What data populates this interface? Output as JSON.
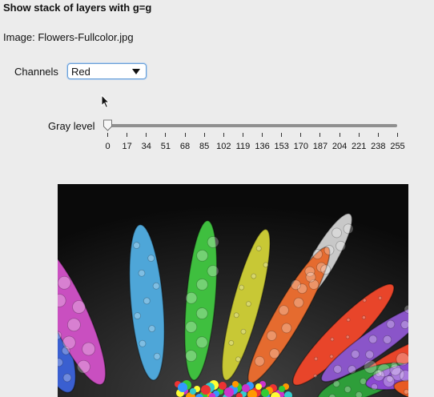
{
  "header": {
    "title": "Show stack of layers with g=g"
  },
  "image": {
    "label": "Image: Flowers-Fullcolor.jpg"
  },
  "channels": {
    "label": "Channels",
    "selected": "Red"
  },
  "gray_level": {
    "label": "Gray level",
    "value": 0,
    "min": 0,
    "max": 255,
    "ticks": [
      "0",
      "17",
      "34",
      "51",
      "68",
      "85",
      "102",
      "119",
      "136",
      "153",
      "170",
      "187",
      "204",
      "221",
      "238",
      "255"
    ]
  },
  "photo": {
    "petal_colors": [
      "#e8362c",
      "#3a5fd0",
      "#c94fc0",
      "#4ea6d8",
      "#3fbf3f",
      "#c8c835",
      "#e56b2f",
      "#e8452a",
      "#8a55c9",
      "#e8452a",
      "#2e9e3a",
      "#8a48d0",
      "#e85a22",
      "#c8c8c8"
    ]
  }
}
